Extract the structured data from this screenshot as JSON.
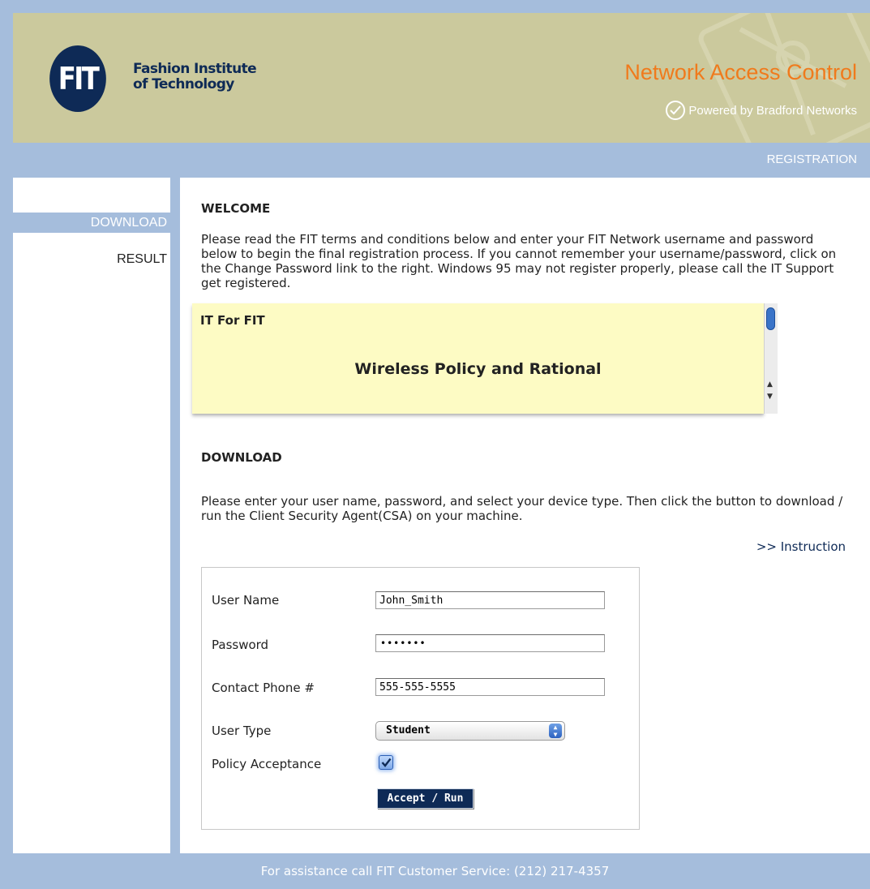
{
  "header": {
    "logo_mark": "FIT",
    "org_line1": "Fashion Institute",
    "org_line2": "of Technology",
    "app_title": "Network Access Control",
    "powered_by": "Powered by Bradford Networks"
  },
  "nav": {
    "current": "REGISTRATION"
  },
  "sidebar": {
    "items": [
      {
        "label": "DOWNLOAD",
        "active": true
      },
      {
        "label": "RESULT",
        "active": false
      }
    ]
  },
  "welcome": {
    "title": "WELCOME",
    "text": "Please read the FIT terms and conditions below and enter your FIT Network username and password below to begin the final registration process. If you cannot remember your username/password, click on the Change Password link to the right. Windows 95 may not register properly, please call the IT Support get registered."
  },
  "policy": {
    "org": "IT For FIT",
    "heading": "Wireless Policy and Rational"
  },
  "download": {
    "title": "DOWNLOAD",
    "text": "Please enter your user name, password, and select your device type. Then click the button to download / run the Client Security Agent(CSA) on your machine.",
    "instruction_link": ">> Instruction"
  },
  "form": {
    "username_label": "User Name",
    "username_value": "John_Smith",
    "password_label": "Password",
    "password_mask": "•••••••",
    "phone_label": "Contact Phone #",
    "phone_value": "555-555-5555",
    "usertype_label": "User Type",
    "usertype_value": "Student",
    "policy_label": "Policy Acceptance",
    "policy_accepted": true,
    "submit_label": "Accept / Run"
  },
  "footer": {
    "text": "For assistance call FIT Customer Service: (212) 217-4357"
  },
  "colors": {
    "frame": "#a5bddc",
    "header_bg": "#cbc99d",
    "brand_navy": "#0e2a56",
    "title_orange": "#f07a1c",
    "policy_bg": "#fdfbc4"
  }
}
